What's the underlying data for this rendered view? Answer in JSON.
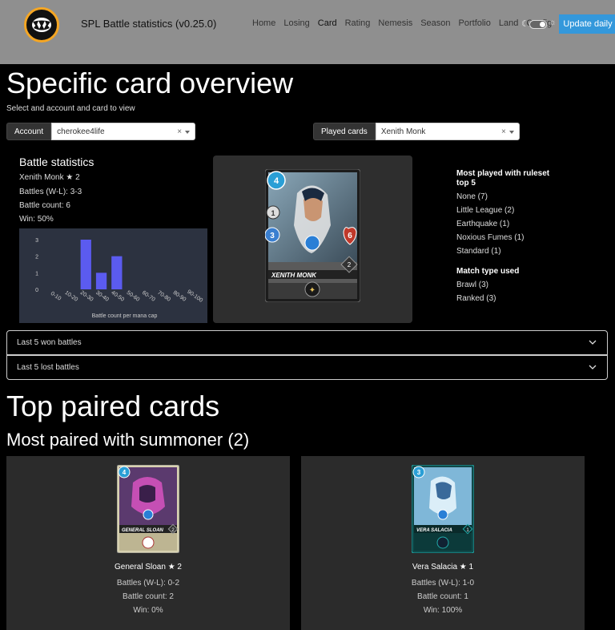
{
  "navbar": {
    "brand": "SPL Battle statistics (v0.25.0)",
    "links": [
      "Home",
      "Losing",
      "Card",
      "Rating",
      "Nemesis",
      "Season",
      "Portfolio",
      "Land",
      "Config"
    ],
    "active": "Card",
    "update_button": "Update daily",
    "accent": "#3498db"
  },
  "page": {
    "title": "Specific card overview",
    "subtitle": "Select and account and card to view"
  },
  "selectors": {
    "account": {
      "label": "Account",
      "value": "cherokee4life",
      "clear": "×"
    },
    "played": {
      "label": "Played cards",
      "value": "Xenith Monk",
      "clear": "×"
    }
  },
  "battle_stats": {
    "title": "Battle statistics",
    "card_name": "Xenith Monk ★ 2",
    "battles": "Battles (W-L): 3-3",
    "count": "Battle count: 6",
    "win": "Win: 50%"
  },
  "card": {
    "name": "XENITH MONK",
    "mana": "4",
    "attack": "1",
    "speed": "3",
    "health": "6",
    "level": "2"
  },
  "chart_data": {
    "type": "bar",
    "categories": [
      "0-10",
      "10-20",
      "20-30",
      "30-40",
      "40-50",
      "50-60",
      "60-70",
      "70-80",
      "80-90",
      "90-100"
    ],
    "values": [
      0,
      0,
      3,
      1,
      2,
      0,
      0,
      0,
      0,
      0
    ],
    "xlabel": "Battle count per mana cap",
    "ylim": [
      0,
      3
    ],
    "yticks": [
      "0",
      "1",
      "2",
      "3"
    ],
    "bar_color": "#5b5bf0",
    "grid": false
  },
  "ruleset": {
    "title": "Most played with ruleset top 5",
    "items": [
      "None (7)",
      "Little League (2)",
      "Earthquake (1)",
      "Noxious Fumes (1)",
      "Standard (1)"
    ],
    "match_title": "Match type used",
    "match_items": [
      "Brawl (3)",
      "Ranked (3)"
    ]
  },
  "accordions": {
    "won": "Last 5 won battles",
    "lost": "Last 5 lost battles"
  },
  "top": {
    "title": "Top paired cards",
    "summoner_title": "Most paired with summoner (2)",
    "cards": [
      {
        "name": "General Sloan ★ 2",
        "battles": "Battles (W-L): 0-2",
        "count": "Battle count: 2",
        "win": "Win: 0%",
        "card_label": "GENERAL SLOAN",
        "mana": "4",
        "level": "2"
      },
      {
        "name": "Vera Salacia ★ 1",
        "battles": "Battles (W-L): 1-0",
        "count": "Battle count: 1",
        "win": "Win: 100%",
        "card_label": "VERA SALACIA",
        "mana": "3",
        "level": "1"
      }
    ]
  }
}
